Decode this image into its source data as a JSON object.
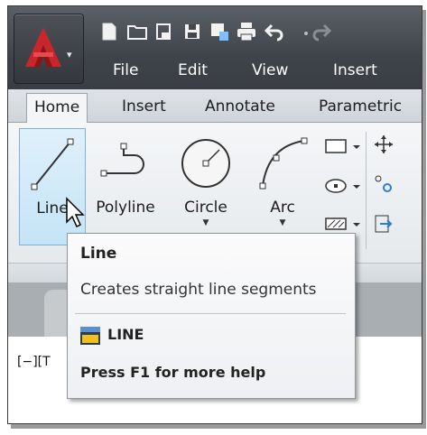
{
  "menubar": {
    "items": [
      "File",
      "Edit",
      "View",
      "Insert"
    ]
  },
  "ribbon": {
    "tabs": [
      "Home",
      "Insert",
      "Annotate",
      "Parametric"
    ],
    "active_tab": "Home",
    "tools": [
      {
        "label": "Line",
        "icon": "line-icon"
      },
      {
        "label": "Polyline",
        "icon": "polyline-icon"
      },
      {
        "label": "Circle",
        "icon": "circle-icon"
      },
      {
        "label": "Arc",
        "icon": "arc-icon"
      }
    ]
  },
  "viewport": {
    "label": "[−][T"
  },
  "tooltip": {
    "title": "Line",
    "description": "Creates straight line segments",
    "command": "LINE",
    "help": "Press F1 for more help"
  },
  "colors": {
    "app_red": "#c8262c",
    "titlebar": "#44484e",
    "hover_blue": "#c4e4f6"
  }
}
